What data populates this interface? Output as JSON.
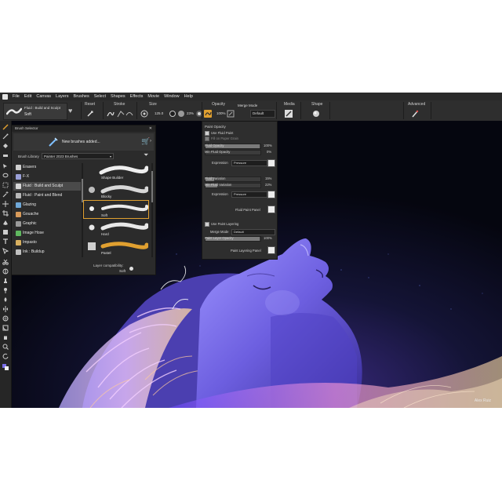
{
  "menubar": {
    "items": [
      "File",
      "Edit",
      "Canvas",
      "Layers",
      "Brushes",
      "Select",
      "Shapes",
      "Effects",
      "Movie",
      "Window",
      "Help"
    ]
  },
  "propbar": {
    "brush_category": "Fluid : Build and Sculpt",
    "brush_variant": "Soft",
    "labels": {
      "reset": "Reset",
      "stroke": "Stroke",
      "size": "Size",
      "opacity": "Opacity",
      "media": "Media",
      "shape": "Shape",
      "advanced": "Advanced"
    },
    "size_value": "125.0",
    "zoom_value": "23%",
    "opacity_value": "100%",
    "merge_mode_label": "Merge Mode",
    "merge_mode_value": "Default"
  },
  "brush_selector": {
    "title": "Brush Selector",
    "banner_text": "New brushes added...",
    "library_label": "Brush Library",
    "library_value": "Painter 2023 Brushes",
    "categories": [
      {
        "label": "Erasers",
        "color": "#cfcfcf",
        "selected": false
      },
      {
        "label": "F-X",
        "color": "#9aa0d8",
        "selected": false
      },
      {
        "label": "Fluid : Build and Sculpt",
        "color": "#d8d8d8",
        "selected": true
      },
      {
        "label": "Fluid : Paint and Blend",
        "color": "#b8b8b8",
        "selected": false
      },
      {
        "label": "Glazing",
        "color": "#6fa8d8",
        "selected": false
      },
      {
        "label": "Gouache",
        "color": "#d89a5a",
        "selected": false
      },
      {
        "label": "Graphic",
        "color": "#9a9a9a",
        "selected": false
      },
      {
        "label": "Image Hose",
        "color": "#5fb85f",
        "selected": false
      },
      {
        "label": "Impasto",
        "color": "#d8b060",
        "selected": false
      },
      {
        "label": "Ink : Buildup",
        "color": "#c0c0c0",
        "selected": false
      }
    ],
    "variants": [
      {
        "label": "Shape Builder",
        "selected": false
      },
      {
        "label": "Blocky",
        "selected": false
      },
      {
        "label": "Soft",
        "selected": true
      },
      {
        "label": "Hard",
        "selected": false
      },
      {
        "label": "Pastel",
        "selected": false
      }
    ],
    "footer_label": "Layer compatibility:",
    "footer_value": "Soft"
  },
  "opacity_panel": {
    "header": "Paint Opacity",
    "use_fluid_paint": "Use Fluid Paint",
    "fluid_sub": "Fill on Paper Grain",
    "fluid_opacity_label": "Fluid Opacity",
    "fluid_opacity_value": "100%",
    "fluid_opacity_fraction": 0.98,
    "min_fluid_opacity_label": "Min Fluid Opacity",
    "min_fluid_opacity_value": "0%",
    "min_fluid_opacity_fraction": 0.0,
    "expression_label": "Expression",
    "expression1_value": "Pressure",
    "fluid_variation_label": "Fluid Variation",
    "fluid_variation_value": "15%",
    "fluid_variation_fraction": 0.15,
    "min_fluid_variation_label": "Min Fluid Variation",
    "min_fluid_variation_value": "22%",
    "min_fluid_variation_fraction": 0.22,
    "expression2_value": "Pressure",
    "fluid_paint_panel": "Fluid Paint Panel",
    "use_paint_layering": "Use Paint Layering",
    "merge_mode_label": "Merge Mode",
    "merge_mode_value": "Default",
    "paint_layer_opacity_label": "Paint Layer Opacity",
    "paint_layer_opacity_value": "100%",
    "paint_layer_opacity_fraction": 0.98,
    "paint_layering_panel": "Paint Layering Panel"
  },
  "canvas": {
    "credit": "Alex Ruiz"
  },
  "colors": {
    "accent_orange": "#e0a030",
    "panel_bg": "#2b2b2b",
    "face_purple": "#7a6ee8"
  }
}
